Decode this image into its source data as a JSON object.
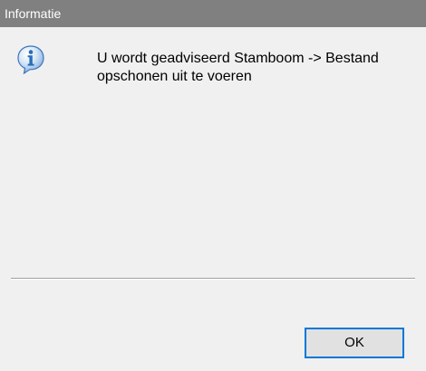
{
  "window": {
    "title": "Informatie"
  },
  "dialog": {
    "icon": "information-icon",
    "message": "U wordt geadviseerd Stamboom -> Bestand opschonen uit te voeren",
    "ok_label": "OK"
  },
  "colors": {
    "titlebar": "#808080",
    "background": "#f0f0f0",
    "button_border": "#0078d7",
    "button_face": "#e1e1e1",
    "icon_blue": "#2a6db8"
  }
}
